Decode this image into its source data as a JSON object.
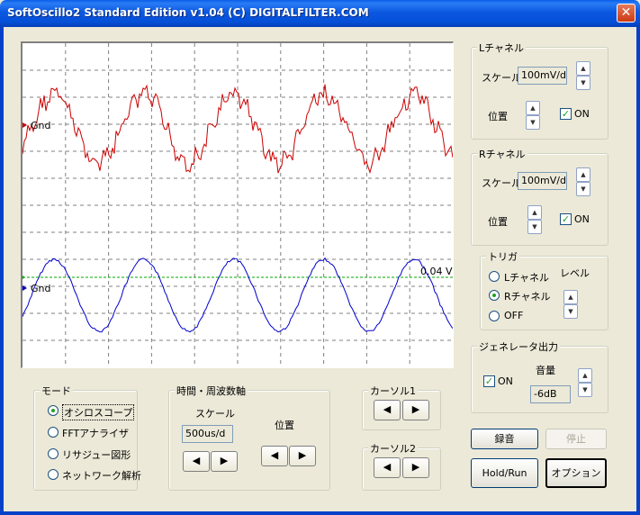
{
  "window": {
    "title": "SoftOscillo2 Standard Edition v1.04 (C) DIGITALFILTER.COM",
    "close_glyph": "✕"
  },
  "scope": {
    "gnd_label_top": "Gnd",
    "gnd_label_bottom": "Gnd",
    "trigger_level_label": "0.04 V",
    "colors": {
      "channel_l": "#cc0000",
      "channel_r": "#0000cc",
      "trigger": "#00aa00",
      "grid": "#808080"
    }
  },
  "l_channel": {
    "group_label": "Lチャネル",
    "scale_label": "スケール",
    "scale_value": "100mV/d",
    "position_label": "位置",
    "on_label": "ON",
    "on_checked": true
  },
  "r_channel": {
    "group_label": "Rチャネル",
    "scale_label": "スケール",
    "scale_value": "100mV/d",
    "position_label": "位置",
    "on_label": "ON",
    "on_checked": true
  },
  "trigger": {
    "group_label": "トリガ",
    "options": [
      "Lチャネル",
      "Rチャネル",
      "OFF"
    ],
    "selected": "Rチャネル",
    "level_label": "レベル"
  },
  "generator": {
    "group_label": "ジェネレータ出力",
    "on_label": "ON",
    "on_checked": true,
    "volume_label": "音量",
    "volume_value": "-6dB"
  },
  "mode": {
    "group_label": "モード",
    "options": [
      "オシロスコープ",
      "FFTアナライザ",
      "リサジュー図形",
      "ネットワーク解析"
    ],
    "selected": "オシロスコープ"
  },
  "timebase": {
    "group_label": "時間・周波数軸",
    "scale_label": "スケール",
    "scale_value": "500us/d",
    "position_label": "位置"
  },
  "cursor1": {
    "group_label": "カーソル1"
  },
  "cursor2": {
    "group_label": "カーソル2"
  },
  "buttons": {
    "record": "録音",
    "stop": "停止",
    "hold_run": "Hold/Run",
    "option": "オプション"
  },
  "icons": {
    "left_arrow": "◀",
    "right_arrow": "▶",
    "spin_up": "▲",
    "spin_down": "▼",
    "check": "✓"
  }
}
